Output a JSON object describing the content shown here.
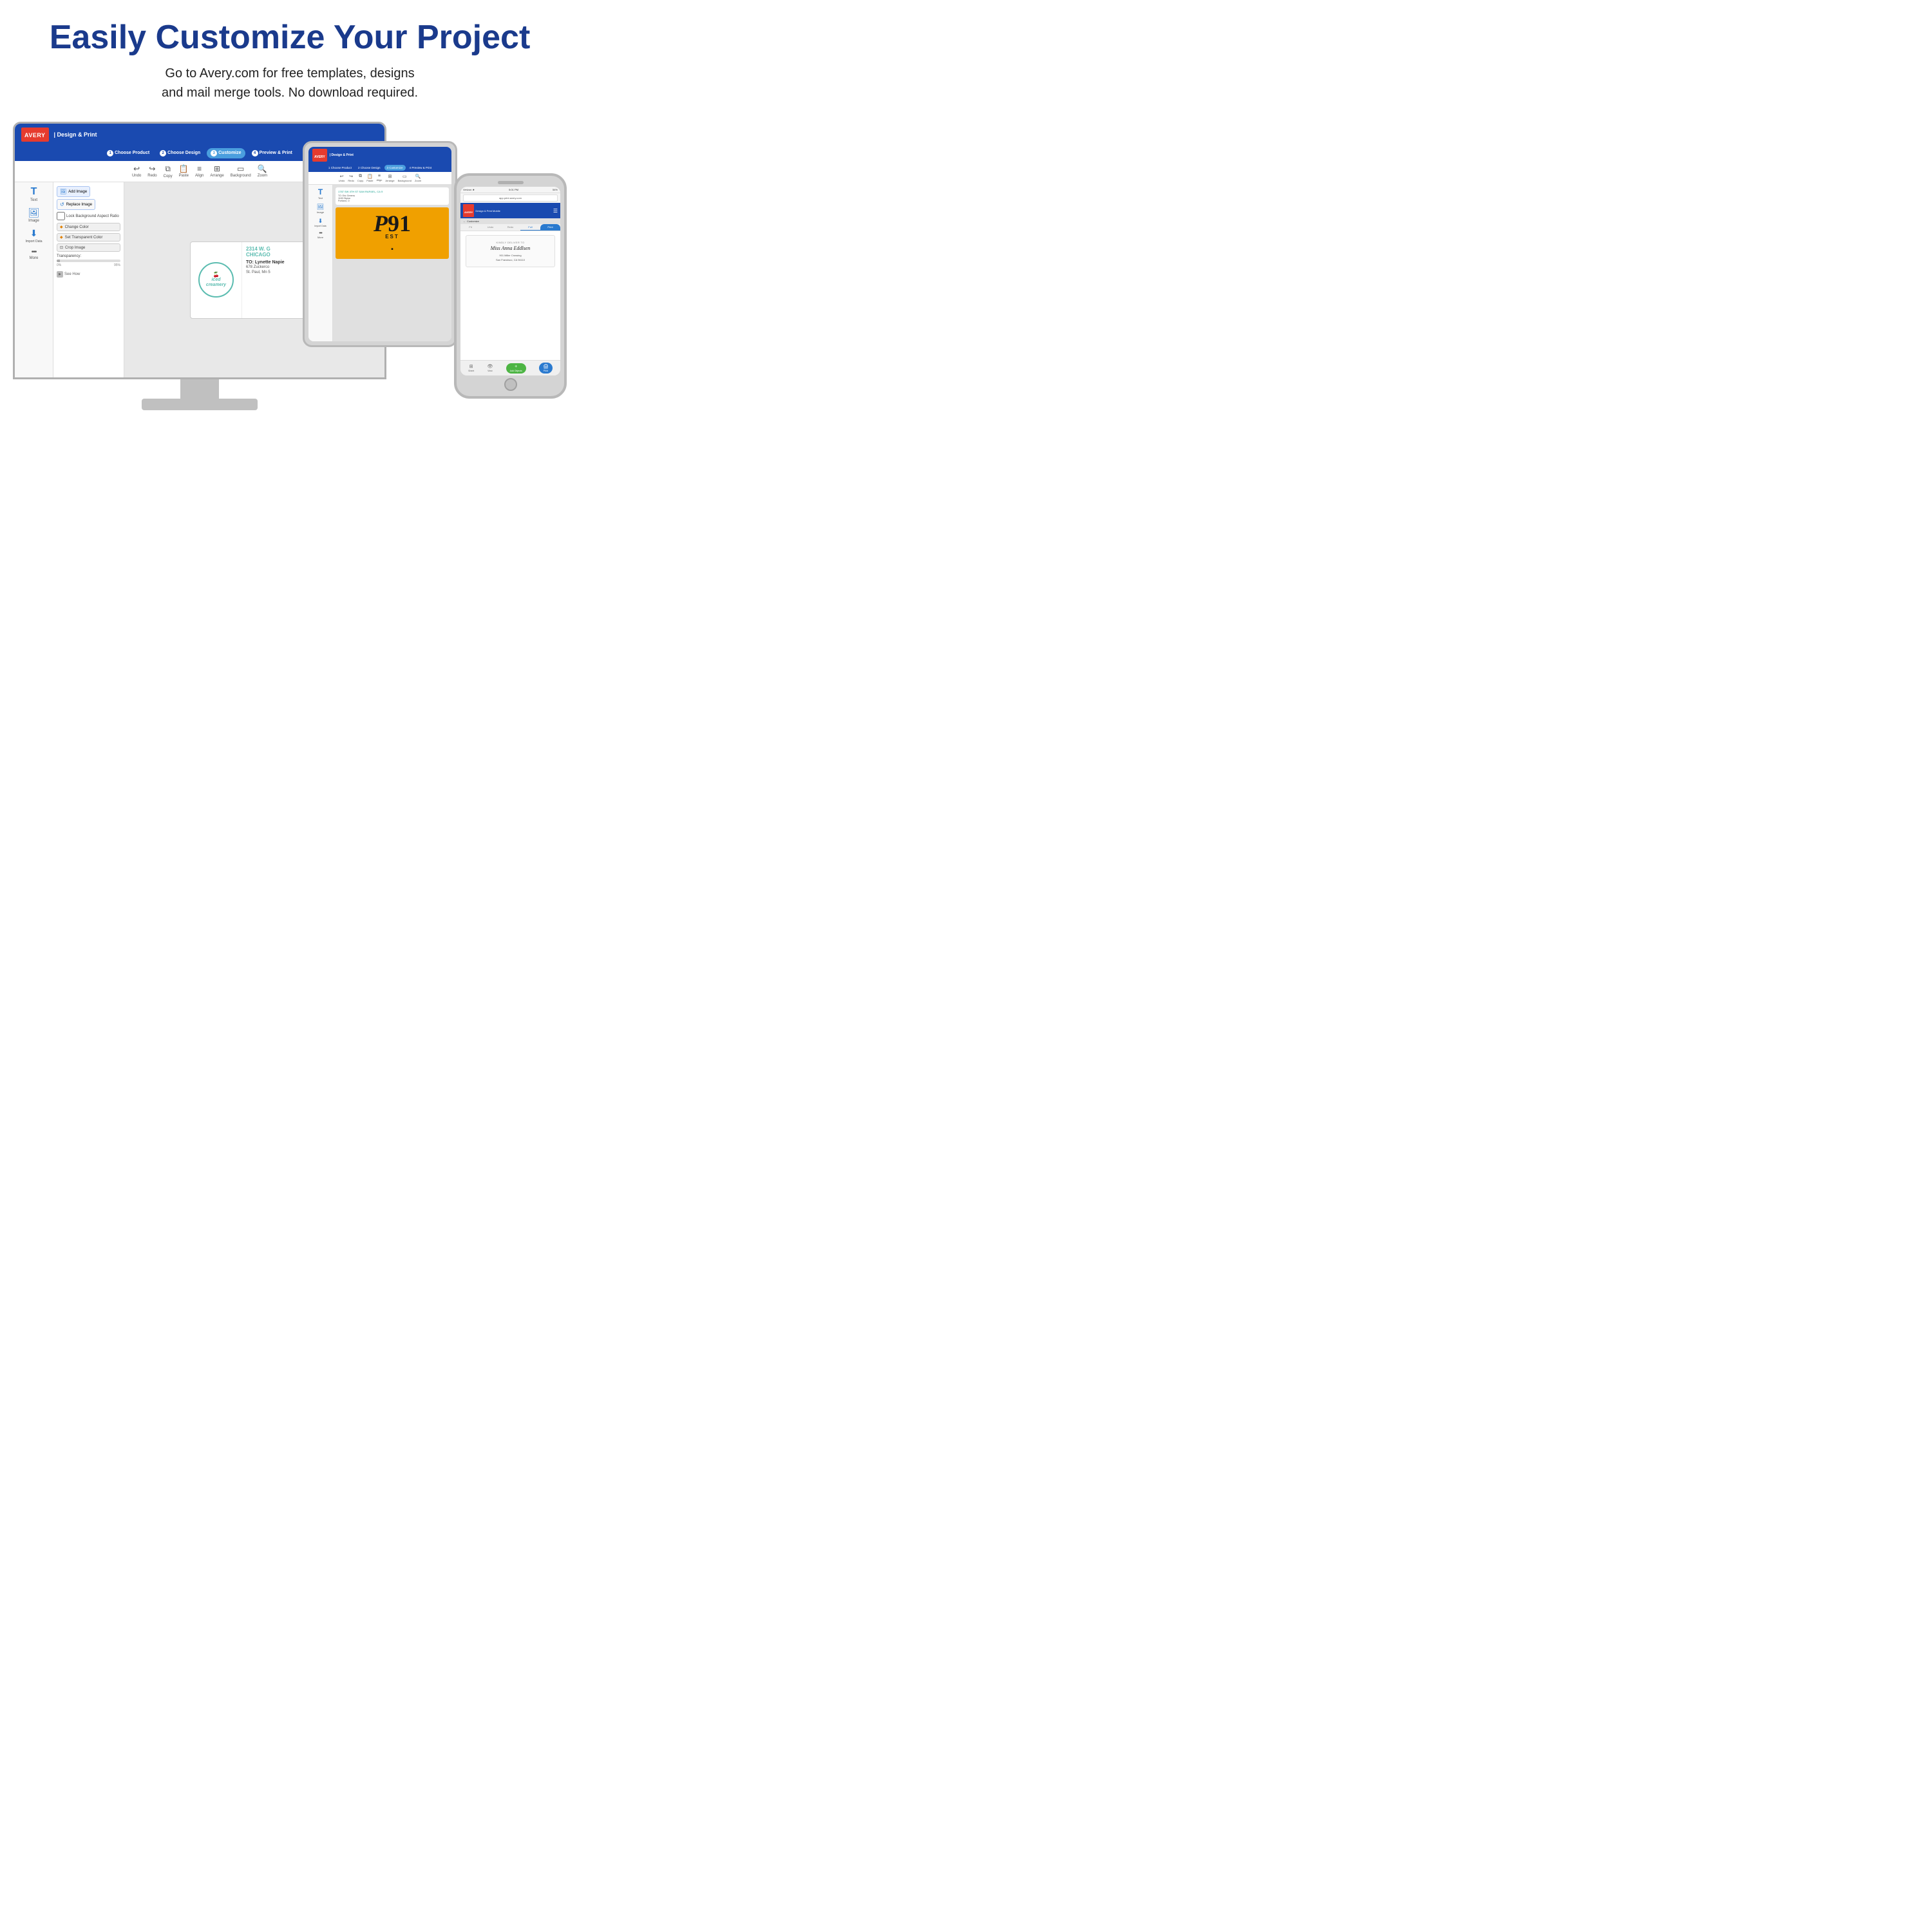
{
  "header": {
    "title": "Easily Customize Your Project",
    "subtitle_line1": "Go to Avery.com for free templates, designs",
    "subtitle_line2": "and mail merge tools. No download required."
  },
  "avery_ui": {
    "logo": "AVERY",
    "brand": "| Design & Print",
    "steps": [
      {
        "num": "1",
        "label": "Choose Product"
      },
      {
        "num": "2",
        "label": "Choose Design"
      },
      {
        "num": "3",
        "label": "Customize",
        "active": true
      },
      {
        "num": "4",
        "label": "Preview & Print"
      }
    ],
    "toolbar": {
      "items": [
        "Undo",
        "Redo",
        "Copy",
        "Paste",
        "Align",
        "Arrange",
        "Background",
        "Zoom"
      ]
    },
    "left_tools": [
      "Text",
      "Image",
      "Import Data",
      "More"
    ],
    "right_panel": {
      "add_image": "Add Image",
      "replace_image": "Replace Image",
      "lock_aspect": "Lock Background Aspect Ratio",
      "change_color": "Change Color",
      "set_transparent": "Set Transparent Color",
      "crop_image": "Crop Image",
      "transparency": "Transparency:",
      "transparency_min": "0%",
      "transparency_max": "95%",
      "see_how": "See How"
    },
    "label_preview": {
      "brand_name": "iced creamery",
      "address_line1": "2314 W. G",
      "city": "CHICAGO",
      "to_label": "TO:",
      "recipient": "Lynette Napie",
      "addr1": "678 Zuckerco",
      "addr2": "St. Paul, Mn 5"
    }
  },
  "tablet_ui": {
    "logo": "AVERY",
    "brand": "| Design & Print",
    "pkg_number": "P91",
    "pkg_est": "EST",
    "period": ".",
    "address_header": "1787 SW 4TH ST SAN RAFAEL, CA 5",
    "to_label": "TO:",
    "recipient": "Eric Greenw",
    "addr1": "1165 Skywa",
    "addr2": "Portland, O"
  },
  "phone_ui": {
    "url": "app.print.avery.com",
    "logo": "AVERY",
    "brand": "Design & Print Mobile",
    "nav_label": "Customize",
    "tabs": [
      "Fit",
      "Undo",
      "Redo",
      "Full"
    ],
    "print_tab": "Print",
    "label_kindly": "KINDLY DELIVER TO",
    "label_name": "Miss Anna Eddlsen",
    "label_addr1": "901 Miller Crossing",
    "label_addr2": "San Francisco, CA 94110",
    "bottom_btns": [
      "Sheet",
      "View",
      "Add Objects",
      "Print"
    ]
  },
  "icons": {
    "text": "T",
    "image": "🖼",
    "import": "⬇",
    "more": "•••",
    "undo": "↩",
    "redo": "↪",
    "copy": "⧉",
    "paste": "📋",
    "align": "≡",
    "arrange": "⧉",
    "background": "▭",
    "zoom": "🔍",
    "add_image": "🖼",
    "replace_image": "↺",
    "diamond": "◆",
    "crop": "⊡",
    "play": "▶",
    "back": "←",
    "menu": "☰",
    "grid": "⊞",
    "eye": "👁",
    "plus": "+",
    "printer": "🖨"
  }
}
